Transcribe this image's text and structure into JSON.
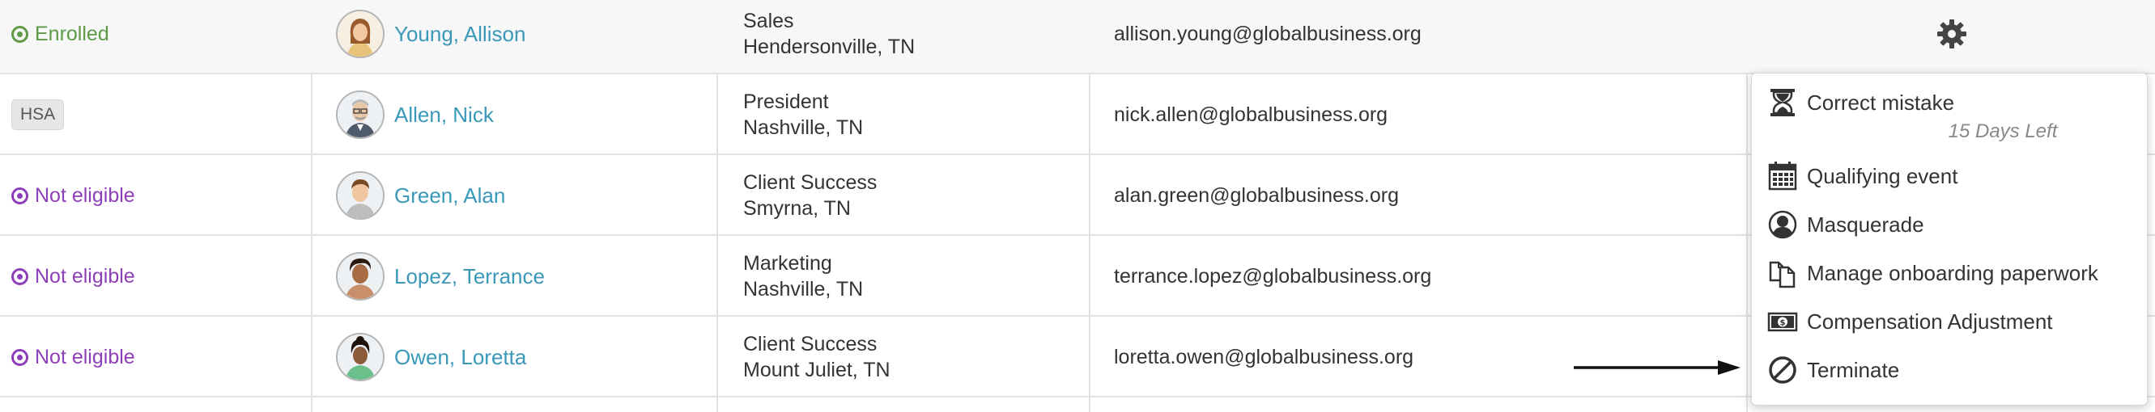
{
  "rows": [
    {
      "status": "Enrolled",
      "name": "Young, Allison",
      "avatar": "avatar-allison",
      "dept": "Sales",
      "location": "Hendersonville, TN",
      "email": "allison.young@globalbusiness.org"
    },
    {
      "status": "HSA",
      "name": "Allen, Nick",
      "avatar": "avatar-nick",
      "dept": "President",
      "location": "Nashville, TN",
      "email": "nick.allen@globalbusiness.org"
    },
    {
      "status": "Not eligible",
      "name": "Green, Alan",
      "avatar": "avatar-alan",
      "dept": "Client Success",
      "location": "Smyrna, TN",
      "email": "alan.green@globalbusiness.org"
    },
    {
      "status": "Not eligible",
      "name": "Lopez, Terrance",
      "avatar": "avatar-terrance",
      "dept": "Marketing",
      "location": "Nashville, TN",
      "email": "terrance.lopez@globalbusiness.org"
    },
    {
      "status": "Not eligible",
      "name": "Owen, Loretta",
      "avatar": "avatar-loretta",
      "dept": "Client Success",
      "location": "Mount Juliet, TN",
      "email": "loretta.owen@globalbusiness.org"
    }
  ],
  "actions_menu": {
    "trigger_icon": "gear-icon",
    "items": [
      {
        "label": "Correct mistake",
        "icon": "hourglass-icon",
        "sublabel": "15 Days Left"
      },
      {
        "label": "Qualifying event",
        "icon": "calendar-icon"
      },
      {
        "label": "Masquerade",
        "icon": "user-circle-icon"
      },
      {
        "label": "Manage onboarding paperwork",
        "icon": "documents-icon"
      },
      {
        "label": "Compensation Adjustment",
        "icon": "banknote-icon"
      },
      {
        "label": "Terminate",
        "icon": "ban-icon"
      }
    ]
  },
  "colors": {
    "enrolled": "#5e9a47",
    "not_eligible": "#8e3fb8",
    "link": "#3a98b9",
    "row_highlight": "#f7f7f7"
  }
}
